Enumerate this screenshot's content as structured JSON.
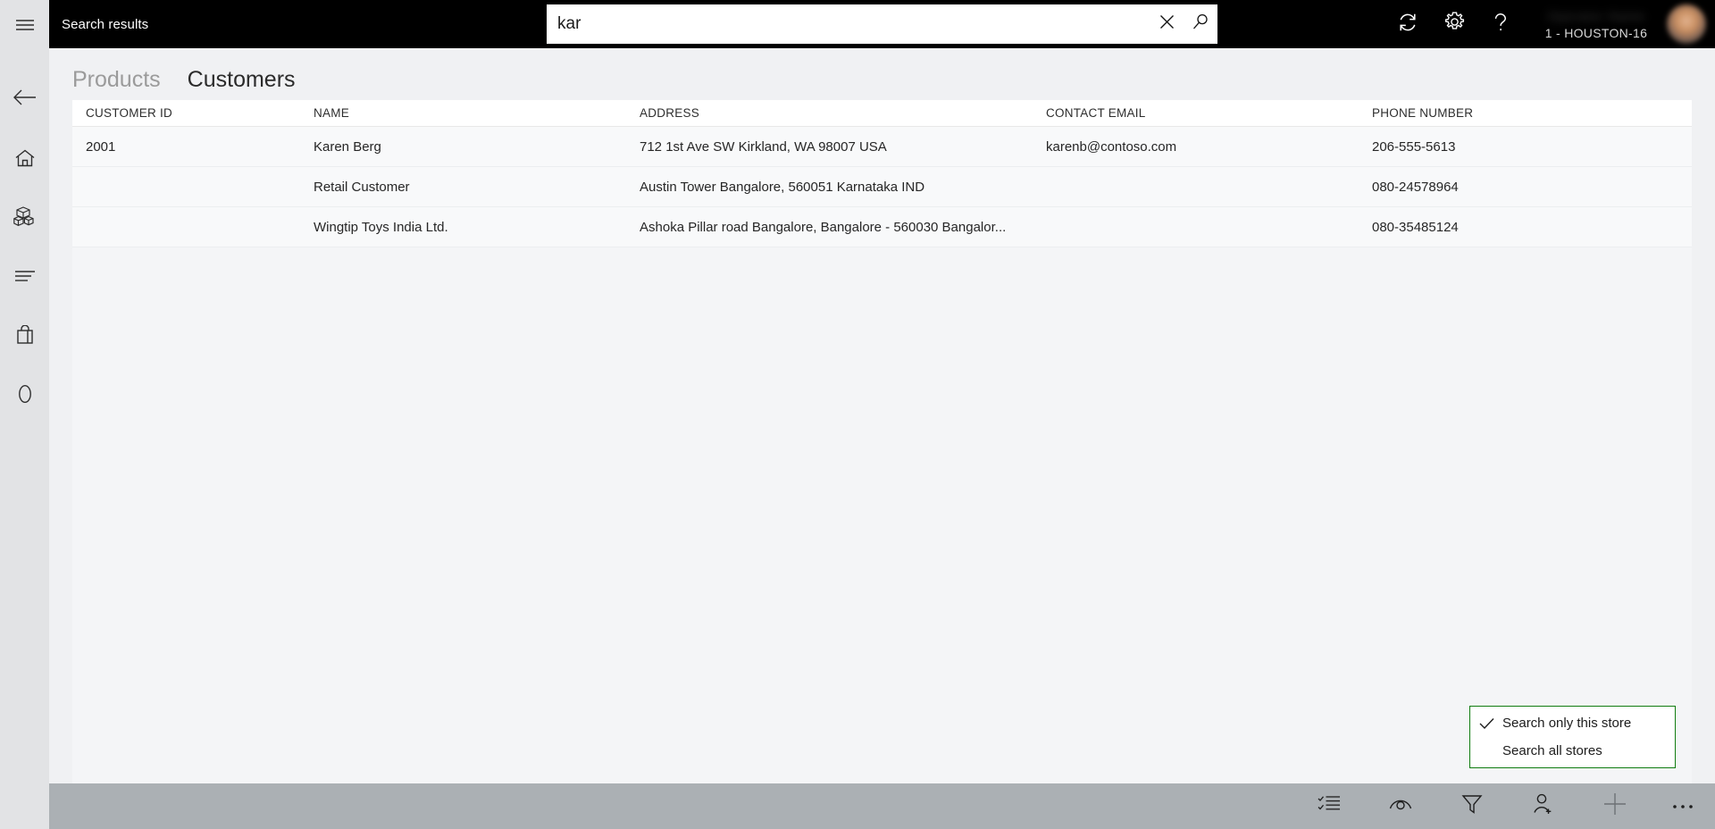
{
  "app": {
    "title": "Search results",
    "accent_green": "#107c10",
    "appbar_color": "#abb0b4"
  },
  "rail": {
    "items": [
      {
        "name": "menu",
        "icon": "hamburger-icon"
      },
      {
        "name": "back",
        "icon": "back-arrow-icon"
      },
      {
        "name": "home",
        "icon": "home-icon"
      },
      {
        "name": "products",
        "icon": "boxes-icon"
      },
      {
        "name": "transactions",
        "icon": "list-lines-icon"
      },
      {
        "name": "shopping-bag",
        "icon": "shopping-bag-icon"
      },
      {
        "name": "cart-count",
        "icon": "zero-icon"
      }
    ]
  },
  "search": {
    "value": "kar",
    "placeholder": "",
    "clear_icon": "close-icon",
    "submit_icon": "search-icon"
  },
  "header": {
    "refresh_icon": "refresh-icon",
    "settings_icon": "gear-icon",
    "help_icon": "help-icon",
    "user_name": "Operator Name",
    "store": "1 - HOUSTON-16"
  },
  "tabs": [
    {
      "label": "Products",
      "active": false
    },
    {
      "label": "Customers",
      "active": true
    }
  ],
  "grid": {
    "columns": [
      "CUSTOMER ID",
      "NAME",
      "ADDRESS",
      "CONTACT EMAIL",
      "PHONE NUMBER"
    ],
    "rows": [
      {
        "customer_id": "2001",
        "name": "Karen Berg",
        "address": "712 1st Ave SW Kirkland, WA 98007 USA",
        "contact_email": "karenb@contoso.com",
        "phone_number": "206-555-5613"
      },
      {
        "customer_id": "",
        "name": "Retail Customer",
        "address": "Austin Tower Bangalore, 560051 Karnataka IND",
        "contact_email": "",
        "phone_number": "080-24578964"
      },
      {
        "customer_id": "",
        "name": "Wingtip Toys India Ltd.",
        "address": "Ashoka Pillar road Bangalore, Bangalore - 560030 Bangalor...",
        "contact_email": "",
        "phone_number": "080-35485124"
      }
    ]
  },
  "flyout": {
    "items": [
      {
        "label": "Search only this store",
        "checked": true
      },
      {
        "label": "Search all stores",
        "checked": false
      }
    ]
  },
  "appbar": {
    "buttons": [
      {
        "name": "select-mode",
        "icon": "checklist-icon"
      },
      {
        "name": "view-details",
        "icon": "eye-icon"
      },
      {
        "name": "filter",
        "icon": "funnel-icon"
      },
      {
        "name": "add-customer",
        "icon": "add-person-icon"
      },
      {
        "name": "add",
        "icon": "plus-icon"
      },
      {
        "name": "more-options",
        "icon": "ellipsis-icon"
      }
    ]
  }
}
